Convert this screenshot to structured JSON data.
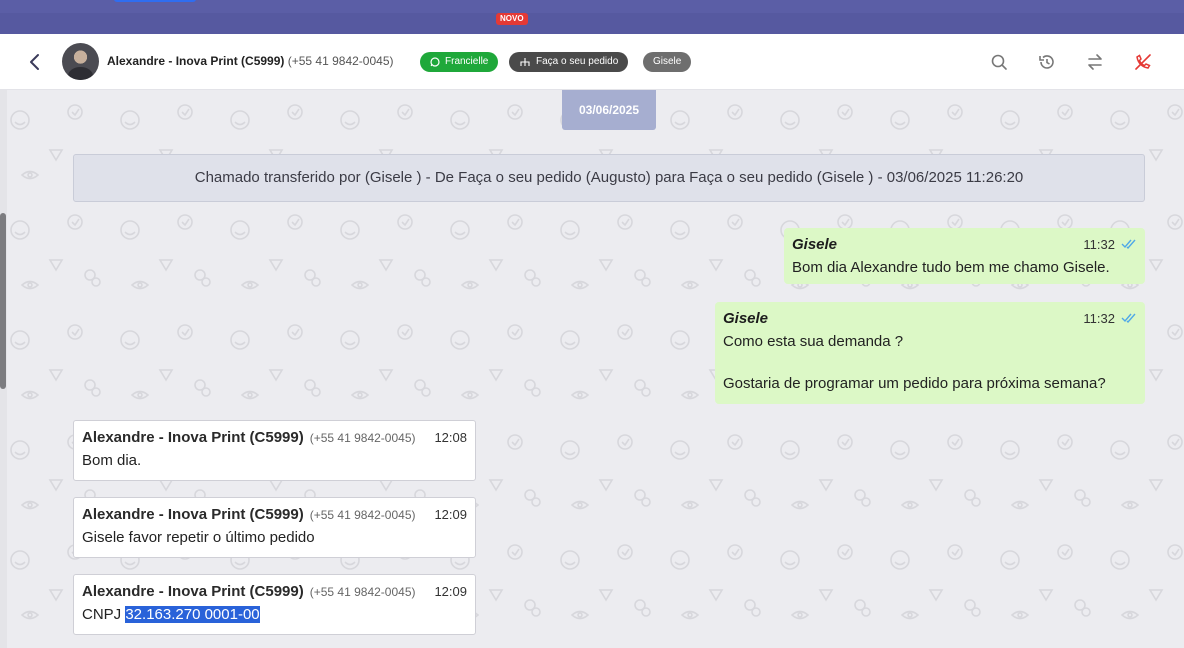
{
  "topbar": {
    "badge": "NOVO"
  },
  "header": {
    "contact_name": "Alexandre - Inova Print (C5999)",
    "contact_phone": "(+55 41 9842-0045)",
    "tags": [
      "Francielle",
      "Faça o seu pedido",
      "Gisele"
    ]
  },
  "chat": {
    "date_separator": "03/06/2025",
    "system_message": "Chamado transferido por (Gisele ) - De Faça o seu pedido (Augusto) para Faça o seu pedido (Gisele ) - 03/06/2025 11:26:20",
    "messages": [
      {
        "direction": "out",
        "author": "Gisele",
        "time": "11:32",
        "lines": [
          "Bom dia Alexandre tudo bem me chamo Gisele."
        ]
      },
      {
        "direction": "out",
        "author": "Gisele",
        "time": "11:32",
        "lines": [
          "Como esta sua demanda ?",
          "",
          "Gostaria de programar um pedido para próxima semana?"
        ]
      },
      {
        "direction": "in",
        "author": "Alexandre - Inova Print (C5999)",
        "phone": "(+55 41 9842-0045)",
        "time": "12:08",
        "text": "Bom dia."
      },
      {
        "direction": "in",
        "author": "Alexandre - Inova Print (C5999)",
        "phone": "(+55 41 9842-0045)",
        "time": "12:09",
        "text": "Gisele favor repetir o último pedido"
      },
      {
        "direction": "in",
        "author": "Alexandre - Inova Print (C5999)",
        "phone": "(+55 41 9842-0045)",
        "time": "12:09",
        "text_prefix": "CNPJ",
        "text_selected": "32.163.270 0001-00"
      }
    ]
  },
  "colors": {
    "outgoing_bubble": "#dcf8c6",
    "incoming_bubble": "#ffffff",
    "accent": "#5b5ea6",
    "whatsapp_tag": "#1fa83a"
  },
  "icons": [
    "back-arrow-icon",
    "whatsapp-icon",
    "sitemap-icon",
    "search-icon",
    "history-icon",
    "transfer-icon",
    "end-chat-icon",
    "double-check-icon"
  ]
}
